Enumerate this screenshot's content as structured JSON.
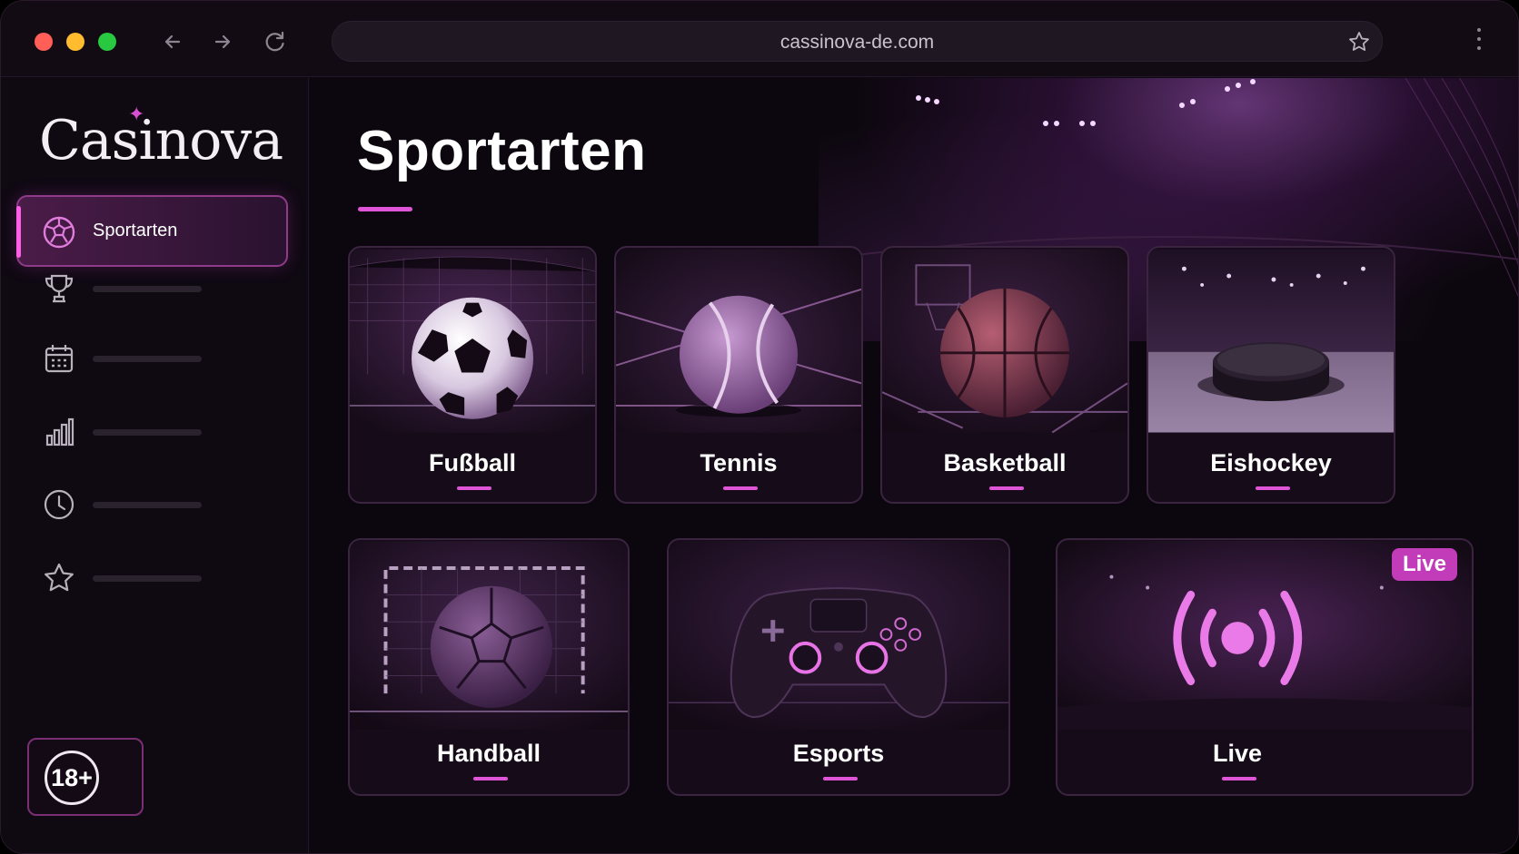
{
  "browser": {
    "url": "cassinova-de.com",
    "back_icon": "arrow-left-icon",
    "forward_icon": "arrow-right-icon",
    "reload_icon": "reload-icon"
  },
  "sidebar": {
    "logo": "Casinova",
    "active_item": {
      "label": "Sportarten",
      "icon": "sports-ball-icon"
    },
    "items": [
      {
        "icon": "trophy-icon"
      },
      {
        "icon": "calendar-icon"
      },
      {
        "icon": "bar-chart-icon"
      },
      {
        "icon": "clock-icon"
      },
      {
        "icon": "star-icon"
      }
    ],
    "age_badge": "18+"
  },
  "main": {
    "title": "Sportarten",
    "sports": [
      {
        "label": "Fußball",
        "icon": "soccer-ball-icon"
      },
      {
        "label": "Tennis",
        "icon": "tennis-ball-icon"
      },
      {
        "label": "Basketball",
        "icon": "basketball-icon"
      },
      {
        "label": "Eishockey",
        "icon": "hockey-puck-icon"
      },
      {
        "label": "Handball",
        "icon": "handball-icon"
      },
      {
        "label": "Esports",
        "icon": "gamepad-icon"
      },
      {
        "label": "Live",
        "icon": "broadcast-icon",
        "badge": "Live"
      }
    ]
  },
  "colors": {
    "accent": "#e055d8",
    "background": "#0c070e",
    "card_border": "#3a2440"
  }
}
